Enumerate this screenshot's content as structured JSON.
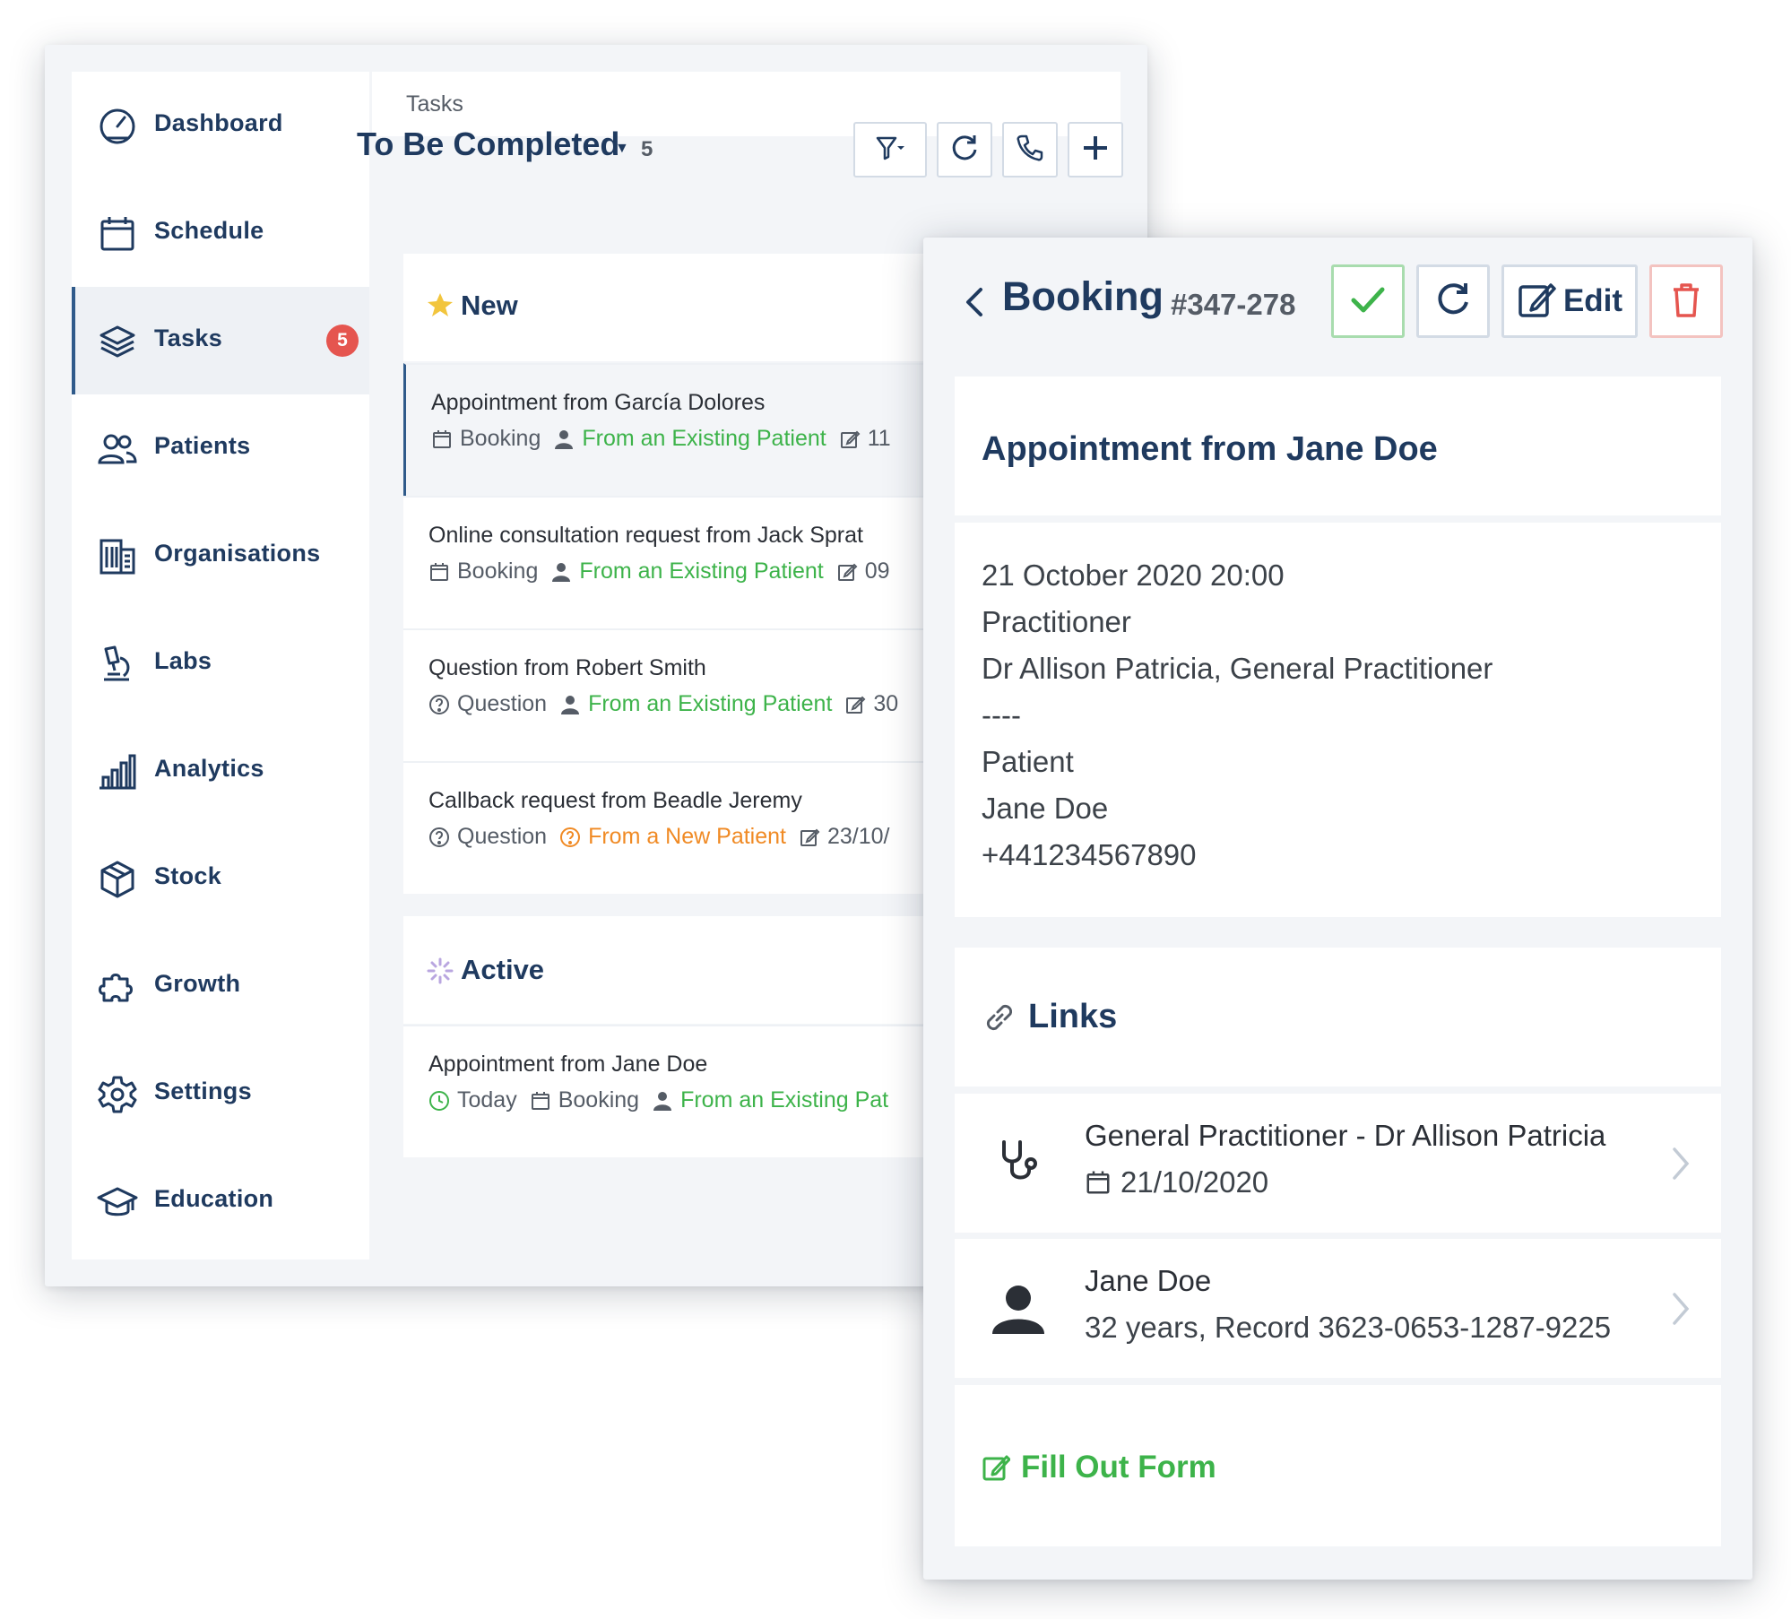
{
  "sidebar": {
    "items": [
      {
        "label": "Dashboard",
        "icon": "gauge-icon"
      },
      {
        "label": "Schedule",
        "icon": "calendar-icon"
      },
      {
        "label": "Tasks",
        "icon": "layers-icon",
        "badge": "5",
        "active": true
      },
      {
        "label": "Patients",
        "icon": "users-icon"
      },
      {
        "label": "Organisations",
        "icon": "building-icon"
      },
      {
        "label": "Labs",
        "icon": "microscope-icon"
      },
      {
        "label": "Analytics",
        "icon": "bar-chart-icon"
      },
      {
        "label": "Stock",
        "icon": "box-icon"
      },
      {
        "label": "Growth",
        "icon": "puzzle-icon"
      },
      {
        "label": "Settings",
        "icon": "gear-icon"
      },
      {
        "label": "Education",
        "icon": "graduation-cap-icon"
      }
    ]
  },
  "breadcrumb": "Tasks",
  "task_list": {
    "title": "To Be Completed",
    "count": "5",
    "toolbar": [
      "filter-icon",
      "refresh-icon",
      "phone-icon",
      "plus-icon"
    ],
    "sections": [
      {
        "title": "New",
        "icon": "star-icon",
        "tasks": [
          {
            "title": "Appointment from García Dolores",
            "type": "Booking",
            "source": "From an Existing Patient",
            "date": "11"
          },
          {
            "title": "Online consultation request from Jack Sprat",
            "type": "Booking",
            "source": "From an Existing Patient",
            "date": "09"
          },
          {
            "title": "Question from Robert Smith",
            "type": "Question",
            "source": "From an Existing Patient",
            "date": "30"
          },
          {
            "title": "Callback request from Beadle Jeremy",
            "type": "Question",
            "source": "From a New Patient",
            "date": "23/10/"
          }
        ]
      },
      {
        "title": "Active",
        "icon": "spinner-icon",
        "tasks": [
          {
            "title": "Appointment from Jane Doe",
            "when": "Today",
            "type": "Booking",
            "source": "From an Existing Pat"
          }
        ]
      }
    ]
  },
  "detail": {
    "title": "Booking",
    "ref": "#347-278",
    "edit_label": "Edit",
    "heading": "Appointment from Jane Doe",
    "info": [
      "21 October 2020 20:00",
      "Practitioner",
      "Dr Allison Patricia, General Practitioner",
      "----",
      "Patient",
      "Jane Doe",
      "+441234567890"
    ],
    "links_title": "Links",
    "links": [
      {
        "title": "General Practitioner - Dr Allison Patricia",
        "sub": "21/10/2020",
        "icon": "stethoscope-icon"
      },
      {
        "title": "Jane Doe",
        "sub": "32 years, Record 3623-0653-1287-9225",
        "icon": "user-icon"
      }
    ],
    "form_label": "Fill Out Form"
  },
  "colors": {
    "navy": "#1f3a5f",
    "green": "#3db34a",
    "orange": "#f08a24",
    "red": "#e5554f"
  }
}
